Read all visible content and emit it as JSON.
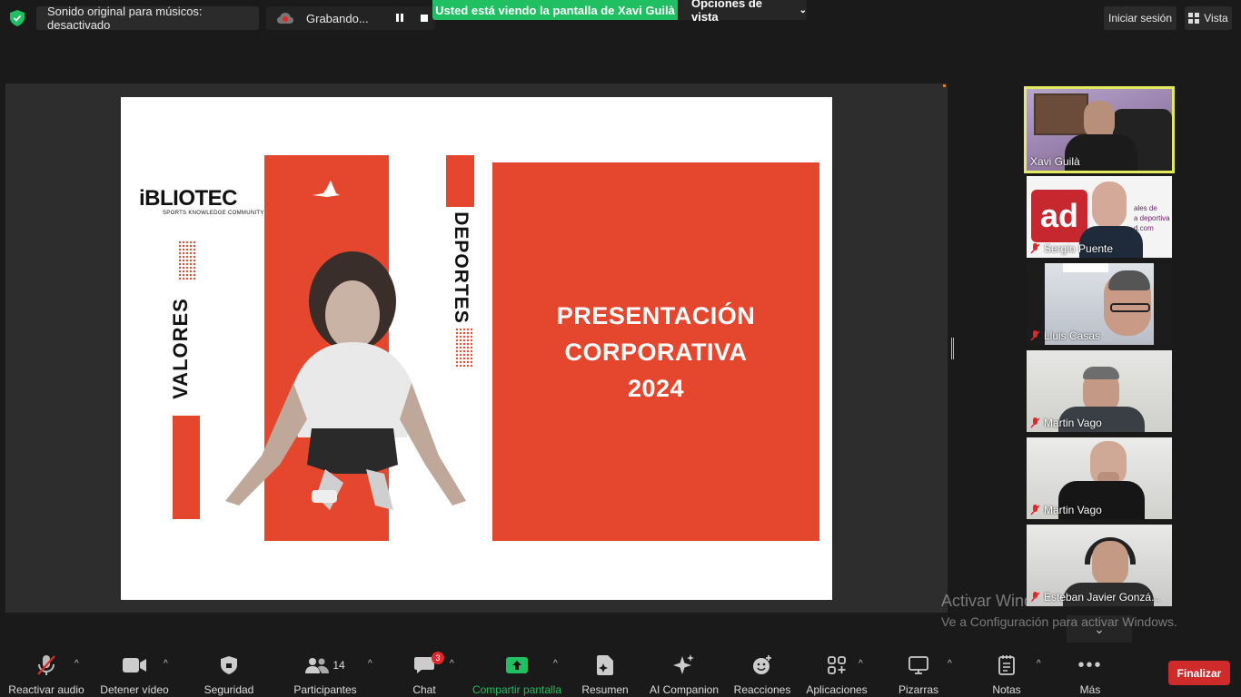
{
  "top": {
    "sound_label": "Sonido original para músicos: desactivado",
    "recording_label": "Grabando...",
    "viewing_banner": "Usted está viendo la pantalla de Xavi Guilà",
    "view_options": "Opciones de vista",
    "signin": "Iniciar sesión",
    "vista": "Vista"
  },
  "slide": {
    "title": "PRESENTACIÓN\nCORPORATIVA\n2024",
    "logo": "iBLIOTEC",
    "logo_sub": "SPORTS KNOWLEDGE COMMUNITY",
    "word_left": "VALORES",
    "word_right": "DEPORTES",
    "accent": "#e5472e"
  },
  "participants": [
    {
      "name": "Xavi Guilà",
      "muted": false,
      "active": true
    },
    {
      "name": "Sergio Puente",
      "muted": true,
      "active": false
    },
    {
      "name": "Lluis Casas",
      "muted": true,
      "active": false
    },
    {
      "name": "Martin Vago",
      "muted": true,
      "active": false
    },
    {
      "name": "Martin Vago",
      "muted": true,
      "active": false
    },
    {
      "name": "Esteban Javier Gonzá...",
      "muted": true,
      "active": false
    }
  ],
  "watermark": {
    "line1": "Activar Windows",
    "line2": "Ve a Configuración para activar Windows."
  },
  "toolbar": {
    "audio": "Reactivar audio",
    "video": "Detener vídeo",
    "security": "Seguridad",
    "participants": "Participantes",
    "participants_count": "14",
    "chat": "Chat",
    "chat_badge": "3",
    "share": "Compartir pantalla",
    "summary": "Resumen",
    "ai": "AI Companion",
    "reactions": "Reacciones",
    "apps": "Aplicaciones",
    "whiteboards": "Pizarras",
    "notes": "Notas",
    "more": "Más",
    "end": "Finalizar",
    "share_color": "#1fbf62",
    "end_color": "#cf2b2b"
  }
}
